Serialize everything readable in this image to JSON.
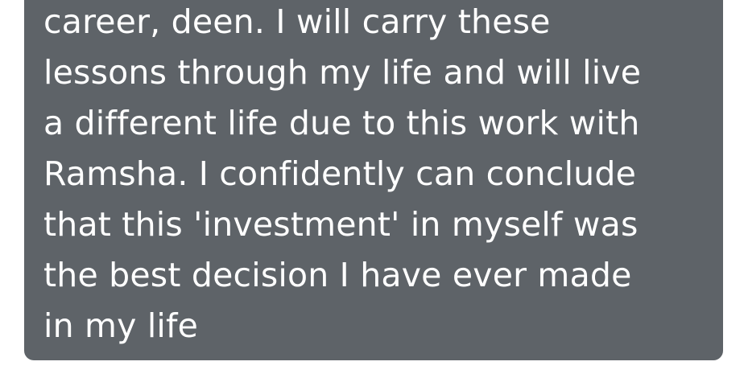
{
  "message": {
    "lines": [
      "career, deen. I will carry these",
      "lessons through my life and will live",
      "a different life due to this work with",
      "Ramsha. I confidently can conclude",
      "that this 'investment' in myself was",
      "the best decision I have ever made",
      "in my life"
    ]
  },
  "colors": {
    "bubble_background": "#5e6368",
    "text": "#ffffff",
    "page_background": "#ffffff"
  }
}
